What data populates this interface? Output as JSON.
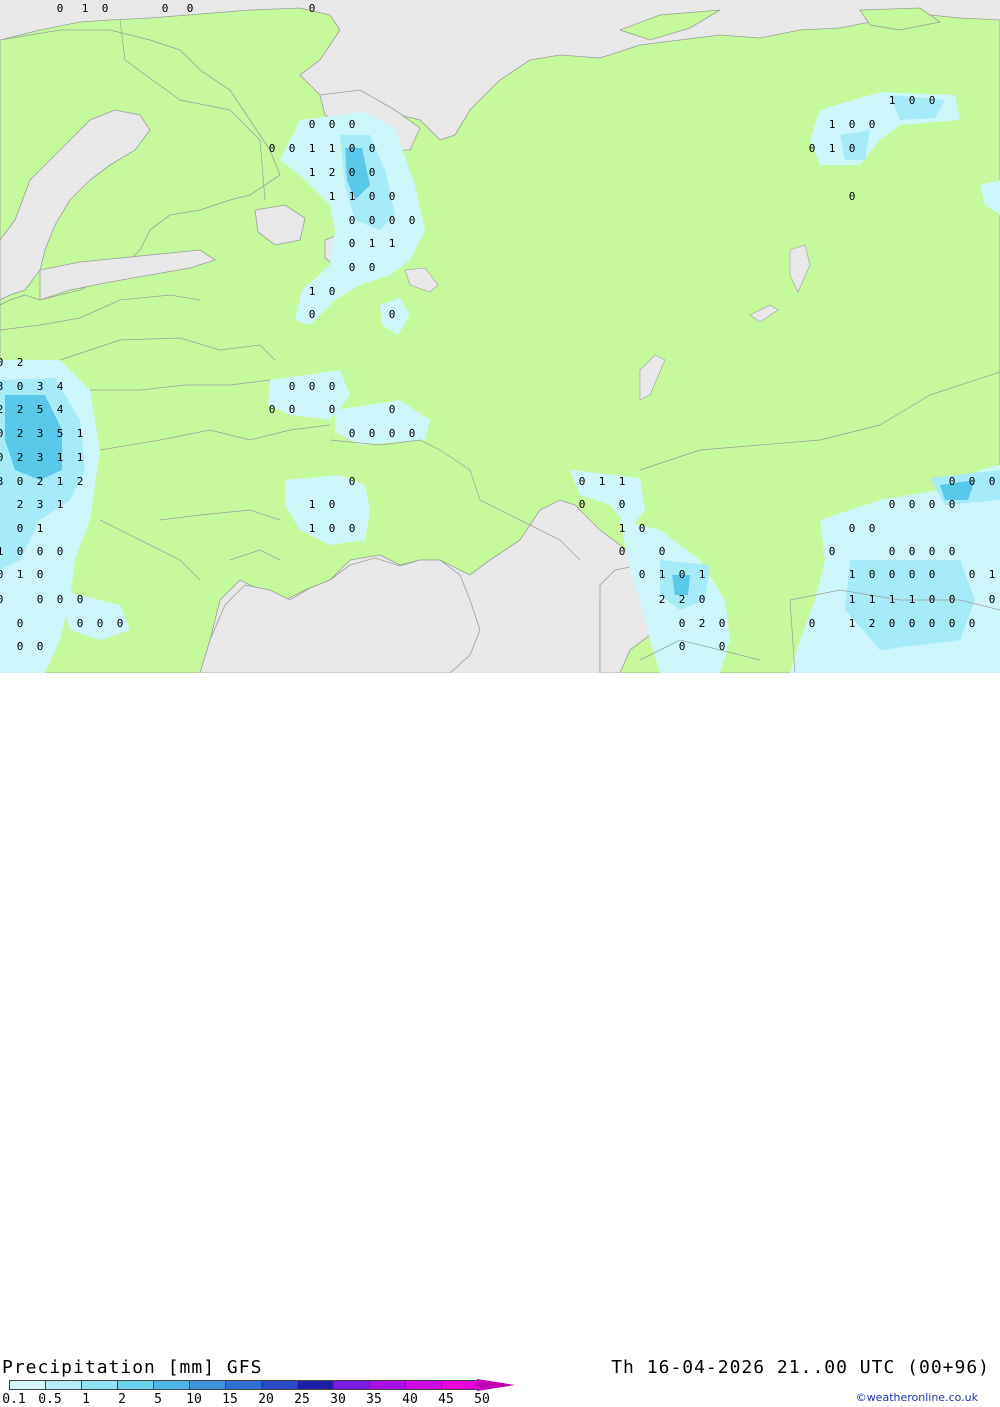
{
  "title": "Precipitation [mm] GFS",
  "valid_time": "Th 16-04-2026 21..00 UTC (00+96)",
  "credit": "©weatheronline.co.uk",
  "colors": {
    "land": "#c6f89c",
    "sea": "#e8e8e8",
    "border": "#9ba39b",
    "precip_light": "#cdf6fb",
    "precip_mid": "#a6ebf8",
    "precip_heavy": "#5ac8ea"
  },
  "legend": {
    "labels": [
      "0.1",
      "0.5",
      "1",
      "2",
      "5",
      "10",
      "15",
      "20",
      "25",
      "30",
      "35",
      "40",
      "45",
      "50"
    ],
    "colors": [
      "#d6f6fa",
      "#b5eef7",
      "#8fe3f2",
      "#6cd3ec",
      "#4fb7e6",
      "#3f92dd",
      "#2f6fd2",
      "#2a48c3",
      "#1f1fa4",
      "#7a19e2",
      "#a80ee8",
      "#cf08e6",
      "#e800dc",
      "#bf00b4"
    ]
  },
  "values": [
    "0",
    "1",
    "0",
    "0",
    "0",
    "0",
    "0",
    "0",
    "0",
    "0",
    "0",
    "1",
    "1",
    "0",
    "0",
    "1",
    "2",
    "0",
    "0",
    "1",
    "1",
    "0",
    "0",
    "0",
    "0",
    "0",
    "0",
    "0",
    "1",
    "1",
    "0",
    "0",
    "1",
    "0",
    "0",
    "0",
    "1",
    "0",
    "0",
    "1",
    "0",
    "0",
    "0",
    "1",
    "0",
    "0",
    "0",
    "2",
    "3",
    "0",
    "3",
    "4",
    "2",
    "2",
    "5",
    "4",
    "0",
    "2",
    "3",
    "5",
    "1",
    "0",
    "2",
    "3",
    "1",
    "1",
    "3",
    "0",
    "2",
    "1",
    "2",
    "2",
    "3",
    "1",
    "0",
    "1",
    "1",
    "0",
    "0",
    "0",
    "0",
    "1",
    "0",
    "0",
    "0",
    "0",
    "0",
    "0",
    "0",
    "0",
    "0",
    "0",
    "0",
    "0",
    "0",
    "0",
    "0",
    "0",
    "0",
    "1",
    "0",
    "1",
    "0",
    "0",
    "0",
    "0",
    "0",
    "0",
    "0",
    "0",
    "0",
    "1",
    "1",
    "0",
    "0",
    "1",
    "0",
    "0",
    "0",
    "0",
    "1",
    "0",
    "1",
    "2",
    "2",
    "0",
    "0",
    "2",
    "0",
    "0",
    "0",
    "0",
    "0",
    "0",
    "0",
    "0",
    "0",
    "0",
    "0",
    "0",
    "0",
    "0",
    "0",
    "0",
    "0",
    "1",
    "0",
    "0",
    "0",
    "0",
    "0",
    "1",
    "1",
    "1",
    "1",
    "1",
    "0",
    "0",
    "0",
    "0",
    "1",
    "2",
    "0",
    "0",
    "0",
    "0",
    "0"
  ]
}
